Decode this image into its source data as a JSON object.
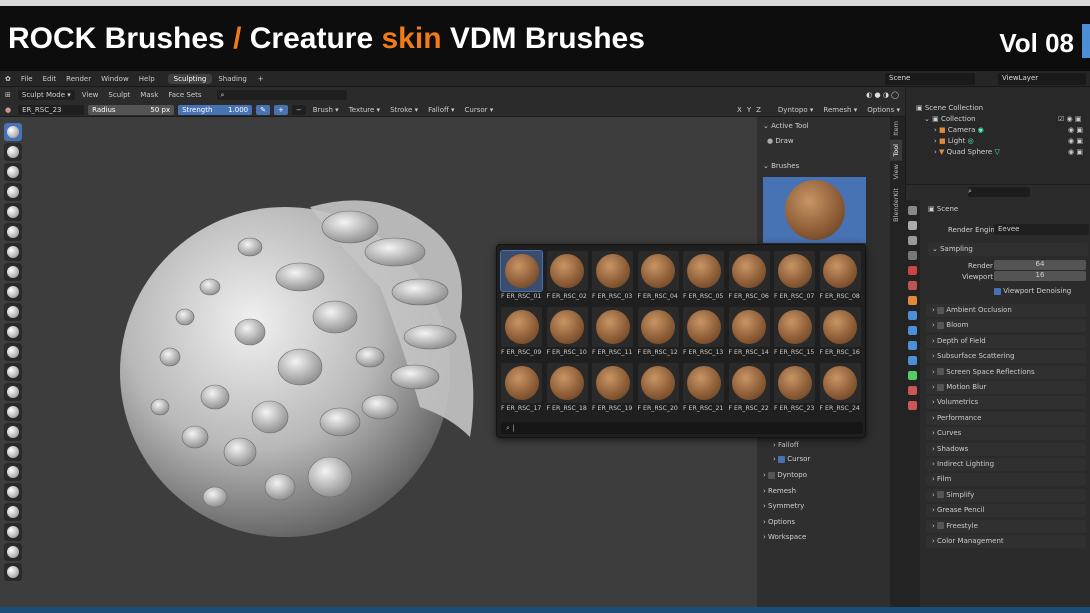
{
  "banner": {
    "title_a": "ROCK Brushes",
    "slash": "/",
    "title_b": "Creature",
    "title_c": "skin",
    "title_d": "VDM Brushes",
    "vol": "Vol 08"
  },
  "menus": [
    "File",
    "Edit",
    "Render",
    "Window",
    "Help"
  ],
  "workspace_tabs": [
    {
      "label": "Sculpting",
      "active": true
    },
    {
      "label": "Shading",
      "active": false
    }
  ],
  "scene_name": "Scene",
  "view_layer": "ViewLayer",
  "header": {
    "mode": "Sculpt Mode",
    "items": [
      "View",
      "Sculpt",
      "Mask",
      "Face Sets"
    ]
  },
  "toolopts": {
    "brush_name": "ER_RSC_23",
    "radius_label": "Radius",
    "radius_value": "50 px",
    "strength_label": "Strength",
    "strength_value": "1.000",
    "menus": [
      "Brush",
      "Texture",
      "Stroke",
      "Falloff",
      "Cursor"
    ],
    "axes": [
      "X",
      "Y",
      "Z"
    ],
    "right_menus": [
      "Dyntopo",
      "Remesh",
      "Options"
    ]
  },
  "sidebar": {
    "active_tool_header": "Active Tool",
    "tool_name": "Draw",
    "brushes_header": "Brushes",
    "sub_items": [
      {
        "label": "Falloff",
        "check": false
      },
      {
        "label": "Cursor",
        "check": true
      }
    ],
    "sections": [
      "Dyntopo",
      "Remesh",
      "Symmetry",
      "Options",
      "Workspace"
    ],
    "tabs": [
      "Item",
      "Tool",
      "View",
      "BlenderKit"
    ]
  },
  "popup": {
    "labels": [
      "ER_RSC_01",
      "ER_RSC_02",
      "ER_RSC_03",
      "ER_RSC_04",
      "ER_RSC_05",
      "ER_RSC_06",
      "ER_RSC_07",
      "ER_RSC_08",
      "ER_RSC_09",
      "ER_RSC_10",
      "ER_RSC_11",
      "ER_RSC_12",
      "ER_RSC_13",
      "ER_RSC_14",
      "ER_RSC_15",
      "ER_RSC_16",
      "ER_RSC_17",
      "ER_RSC_18",
      "ER_RSC_19",
      "ER_RSC_20",
      "ER_RSC_21",
      "ER_RSC_22",
      "ER_RSC_23",
      "ER_RSC_24"
    ],
    "prefix": "F"
  },
  "outliner": {
    "root": "Scene Collection",
    "collection": "Collection",
    "items": [
      "Camera",
      "Light",
      "Quad Sphere"
    ]
  },
  "properties": {
    "scene": "Scene",
    "render_engine_label": "Render Engine",
    "render_engine_value": "Eevee",
    "sampling_header": "Sampling",
    "render_label": "Render",
    "render_value": "64",
    "viewport_label": "Viewport",
    "viewport_value": "16",
    "denoise_label": "Viewport Denoising",
    "sections": [
      {
        "label": "Ambient Occlusion",
        "check": true
      },
      {
        "label": "Bloom",
        "check": true
      },
      {
        "label": "Depth of Field",
        "check": false
      },
      {
        "label": "Subsurface Scattering",
        "check": false
      },
      {
        "label": "Screen Space Reflections",
        "check": true
      },
      {
        "label": "Motion Blur",
        "check": true
      },
      {
        "label": "Volumetrics",
        "check": false
      },
      {
        "label": "Performance",
        "check": false
      },
      {
        "label": "Curves",
        "check": false
      },
      {
        "label": "Shadows",
        "check": false
      },
      {
        "label": "Indirect Lighting",
        "check": false
      },
      {
        "label": "Film",
        "check": false
      },
      {
        "label": "Simplify",
        "check": true
      },
      {
        "label": "Grease Pencil",
        "check": false
      },
      {
        "label": "Freestyle",
        "check": true
      },
      {
        "label": "Color Management",
        "check": false
      }
    ]
  }
}
